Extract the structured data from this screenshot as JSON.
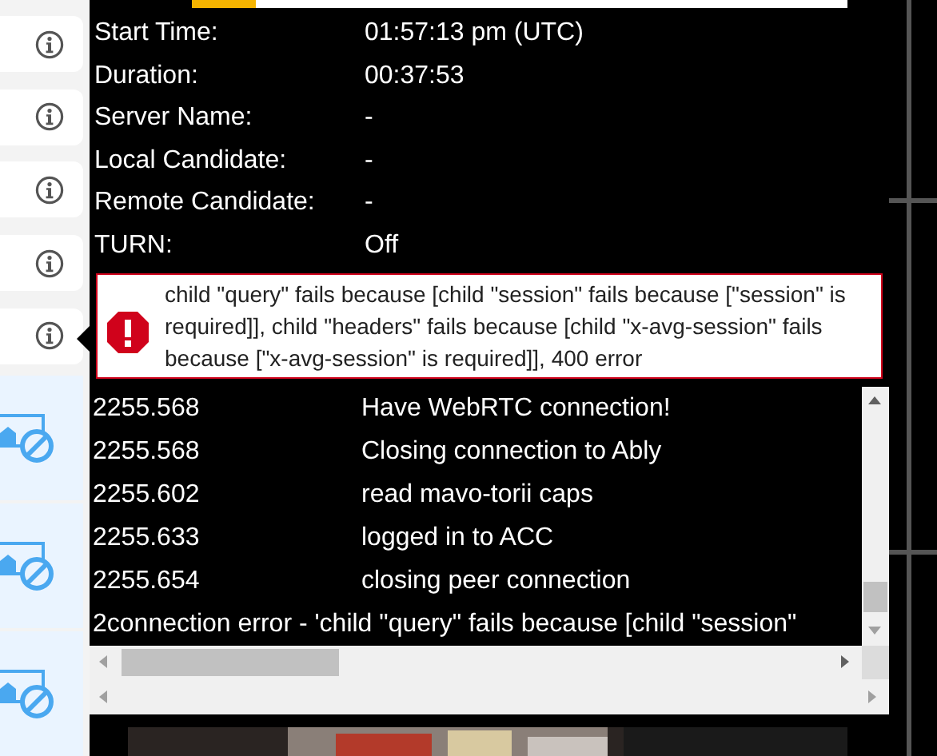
{
  "sidebar": {
    "items": [
      {
        "kind": "info",
        "selected": false
      },
      {
        "kind": "info",
        "selected": false
      },
      {
        "kind": "info",
        "selected": false
      },
      {
        "kind": "info",
        "selected": false
      },
      {
        "kind": "info",
        "selected": true
      },
      {
        "kind": "camera",
        "selected": false
      },
      {
        "kind": "camera",
        "selected": false
      },
      {
        "kind": "camera",
        "selected": false
      }
    ]
  },
  "session_info": [
    {
      "label": "Start Time:",
      "value": "01:57:13 pm (UTC)"
    },
    {
      "label": "Duration:",
      "value": "00:37:53"
    },
    {
      "label": "Server Name:",
      "value": "-"
    },
    {
      "label": "Local Candidate:",
      "value": "-"
    },
    {
      "label": "Remote Candidate:",
      "value": "-"
    },
    {
      "label": "TURN:",
      "value": "Off"
    }
  ],
  "error": {
    "message": "child \"query\" fails because [child \"session\" fails because [\"session\" is required]], child \"headers\" fails because [child \"x-avg-session\" fails because [\"x-avg-session\" is required]], 400 error"
  },
  "log": [
    {
      "kind": "entry",
      "time": "2255.568",
      "message": "Have WebRTC connection!"
    },
    {
      "kind": "entry",
      "time": "2255.568",
      "message": "Closing connection to Ably"
    },
    {
      "kind": "entry",
      "time": "2255.602",
      "message": "read mavo-torii caps"
    },
    {
      "kind": "entry",
      "time": "2255.633",
      "message": "logged in to ACC"
    },
    {
      "kind": "entry",
      "time": "2255.654",
      "message": "closing peer connection"
    },
    {
      "kind": "overflow",
      "text": "2connection error - 'child \"query\" fails because [child \"session\""
    }
  ]
}
